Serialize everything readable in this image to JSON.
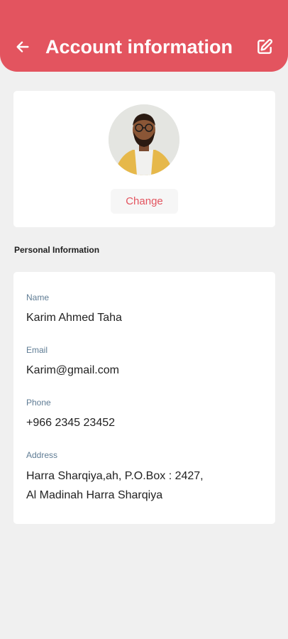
{
  "header": {
    "title": "Account information",
    "back_icon": "arrow-left-icon",
    "edit_icon": "edit-icon",
    "background_color": "#e3545f"
  },
  "profile": {
    "avatar": "profile-photo",
    "change_label": "Change"
  },
  "personal_info": {
    "section_title": "Personal Information",
    "fields": [
      {
        "label": "Name",
        "value": "Karim Ahmed Taha"
      },
      {
        "label": "Email",
        "value": "Karim@gmail.com"
      },
      {
        "label": "Phone",
        "value": "+966 2345 23452"
      },
      {
        "label": "Address",
        "value_lines": [
          "Harra Sharqiya,ah, P.O.Box : 2427,",
          "Al Madinah Harra Sharqiya"
        ]
      }
    ]
  }
}
